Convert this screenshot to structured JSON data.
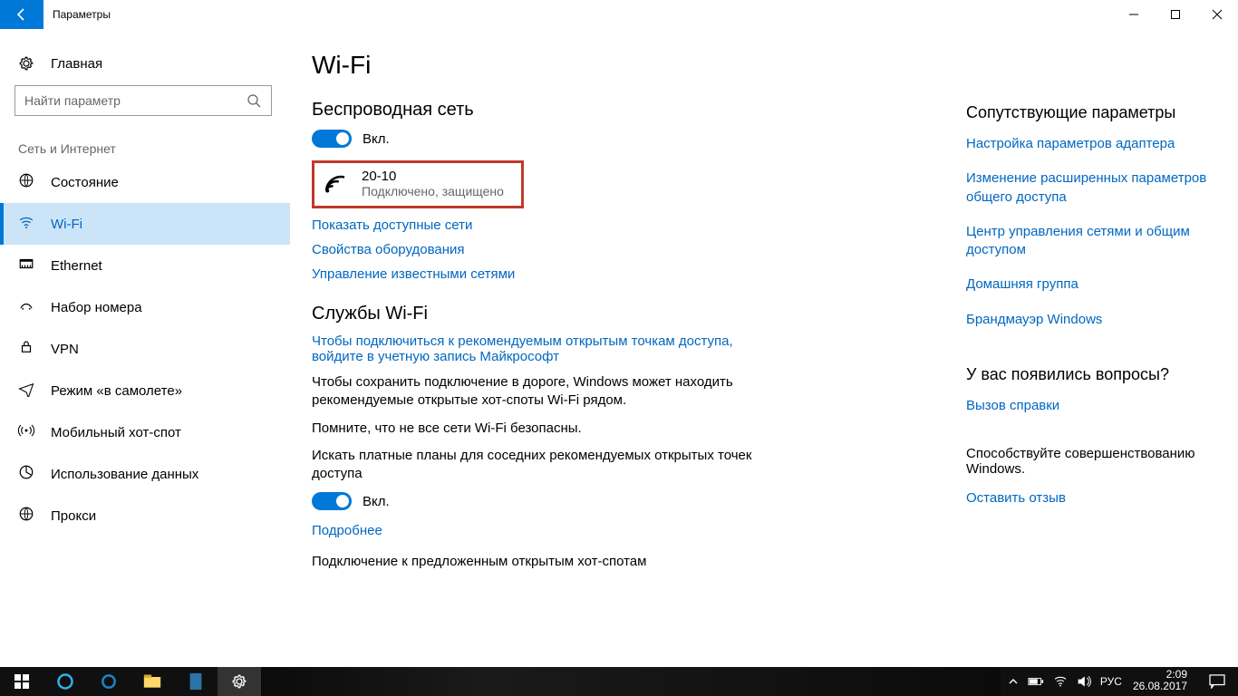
{
  "titlebar": {
    "title": "Параметры"
  },
  "sidebar": {
    "home": "Главная",
    "search_placeholder": "Найти параметр",
    "category": "Сеть и Интернет",
    "items": [
      {
        "key": "status",
        "label": "Состояние"
      },
      {
        "key": "wifi",
        "label": "Wi-Fi"
      },
      {
        "key": "ethernet",
        "label": "Ethernet"
      },
      {
        "key": "dialup",
        "label": "Набор номера"
      },
      {
        "key": "vpn",
        "label": "VPN"
      },
      {
        "key": "airplane",
        "label": "Режим «в самолете»"
      },
      {
        "key": "hotspot",
        "label": "Мобильный хот-спот"
      },
      {
        "key": "datausage",
        "label": "Использование данных"
      },
      {
        "key": "proxy",
        "label": "Прокси"
      }
    ]
  },
  "content": {
    "page_title": "Wi-Fi",
    "wireless_heading": "Беспроводная сеть",
    "toggle_on_label": "Вкл.",
    "network": {
      "ssid": "20-10",
      "status": "Подключено, защищено"
    },
    "links": {
      "show_networks": "Показать доступные сети",
      "hw_props": "Свойства оборудования",
      "manage_known": "Управление известными сетями",
      "signin": "Чтобы подключиться к рекомендуемым открытым точкам доступа, войдите в учетную запись Майкрософт",
      "learn_more": "Подробнее"
    },
    "wifi_services_heading": "Службы Wi-Fi",
    "para_roaming": "Чтобы сохранить подключение в дороге, Windows может находить рекомендуемые открытые хот-споты Wi-Fi рядом.",
    "para_warn": "Помните, что не все сети Wi-Fi безопасны.",
    "para_paid": "Искать платные планы для соседних рекомендуемых открытых точек доступа",
    "para_suggested": "Подключение к предложенным открытым хот-спотам"
  },
  "right": {
    "related_heading": "Сопутствующие параметры",
    "links": [
      "Настройка параметров адаптера",
      "Изменение расширенных параметров общего доступа",
      "Центр управления сетями и общим доступом",
      "Домашняя группа",
      "Брандмауэр Windows"
    ],
    "questions_heading": "У вас появились вопросы?",
    "help_link": "Вызов справки",
    "improve_heading": "Способствуйте совершенствованию Windows.",
    "feedback_link": "Оставить отзыв"
  },
  "taskbar": {
    "lang": "РУС",
    "time": "2:09",
    "date": "26.08.2017"
  }
}
